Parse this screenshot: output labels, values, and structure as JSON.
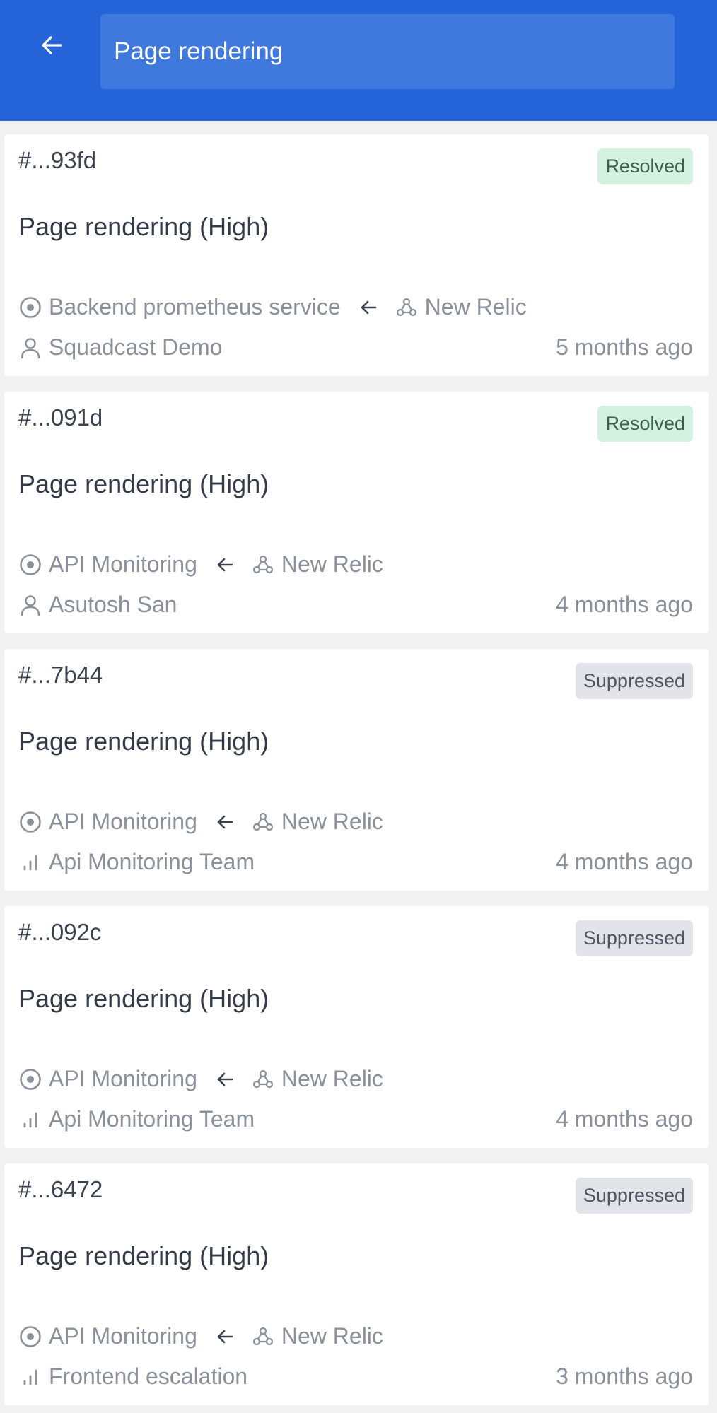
{
  "header": {
    "back_icon": "arrow-left-icon",
    "search_value": "Page rendering",
    "background": "#2563d9"
  },
  "incidents": [
    {
      "id": "#...93fd",
      "status": "Resolved",
      "status_kind": "resolved",
      "title": "Page rendering (High)",
      "service": "Backend prometheus service",
      "source": "New Relic",
      "owner": "Squadcast Demo",
      "owner_type": "user",
      "time": "5 months ago"
    },
    {
      "id": "#...091d",
      "status": "Resolved",
      "status_kind": "resolved",
      "title": "Page rendering (High)",
      "service": "API Monitoring",
      "source": "New Relic",
      "owner": "Asutosh San",
      "owner_type": "user",
      "time": "4 months ago"
    },
    {
      "id": "#...7b44",
      "status": "Suppressed",
      "status_kind": "suppressed",
      "title": "Page rendering (High)",
      "service": "API Monitoring",
      "source": "New Relic",
      "owner": "Api Monitoring Team",
      "owner_type": "team",
      "time": "4 months ago"
    },
    {
      "id": "#...092c",
      "status": "Suppressed",
      "status_kind": "suppressed",
      "title": "Page rendering (High)",
      "service": "API Monitoring",
      "source": "New Relic",
      "owner": "Api Monitoring Team",
      "owner_type": "team",
      "time": "4 months ago"
    },
    {
      "id": "#...6472",
      "status": "Suppressed",
      "status_kind": "suppressed",
      "title": "Page rendering (High)",
      "service": "API Monitoring",
      "source": "New Relic",
      "owner": "Frontend escalation",
      "owner_type": "team",
      "time": "3 months ago"
    }
  ],
  "colors": {
    "resolved_badge_bg": "#d4f2df",
    "suppressed_badge_bg": "#e2e4ea",
    "page_bg": "#f2f2f3"
  }
}
